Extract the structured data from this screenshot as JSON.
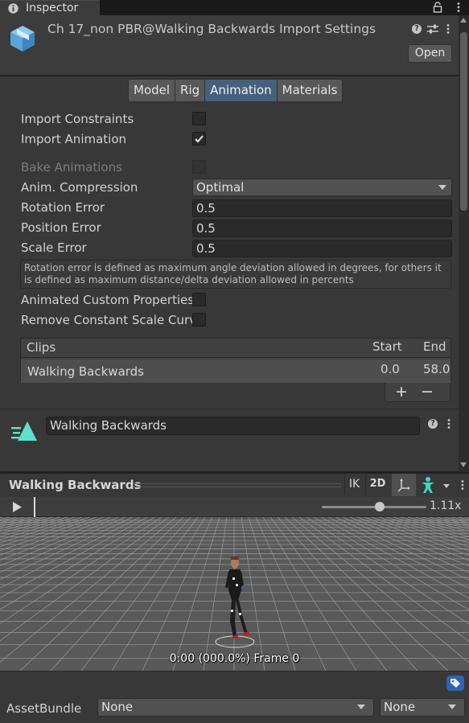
{
  "tab": {
    "label": "Inspector",
    "icon": "info-icon"
  },
  "header": {
    "title": "Ch 17_non PBR@Walking Backwards Import Settings",
    "open_label": "Open"
  },
  "tabs": [
    {
      "label": "Model",
      "active": false
    },
    {
      "label": "Rig",
      "active": false
    },
    {
      "label": "Animation",
      "active": true
    },
    {
      "label": "Materials",
      "active": false
    }
  ],
  "settings": {
    "import_constraints": {
      "label": "Import Constraints",
      "checked": false
    },
    "import_animation": {
      "label": "Import Animation",
      "checked": true
    },
    "bake_animations": {
      "label": "Bake Animations",
      "checked": false,
      "disabled": true
    },
    "anim_compression": {
      "label": "Anim. Compression",
      "value": "Optimal"
    },
    "rotation_error": {
      "label": "Rotation Error",
      "value": "0.5"
    },
    "position_error": {
      "label": "Position Error",
      "value": "0.5"
    },
    "scale_error": {
      "label": "Scale Error",
      "value": "0.5"
    },
    "help_text": "Rotation error is defined as maximum angle deviation allowed in degrees, for others it is defined as maximum distance/delta deviation allowed in percents",
    "animated_custom_properties": {
      "label": "Animated Custom Properties",
      "checked": false
    },
    "remove_constant_scale": {
      "label": "Remove Constant Scale Curv",
      "checked": false
    }
  },
  "clips": {
    "header": {
      "name": "Clips",
      "start": "Start",
      "end": "End"
    },
    "rows": [
      {
        "name": "Walking Backwards",
        "start": "0.0",
        "end": "58.0"
      }
    ],
    "add_label": "+",
    "remove_label": "−"
  },
  "clip_name": "Walking Backwards",
  "preview": {
    "title": "Walking Backwards",
    "ik_label": "IK",
    "two_d_label": "2D",
    "speed": "1.11x",
    "speed_fraction": 0.55,
    "frame_text": "0:00 (000.0%) Frame 0"
  },
  "asset_bundle": {
    "label": "AssetBundle",
    "name_value": "None",
    "variant_value": "None"
  },
  "colors": {
    "active_tab": "#46607c",
    "tag_icon": "#2f63ad",
    "clip_icon": "#5fe0c8"
  }
}
